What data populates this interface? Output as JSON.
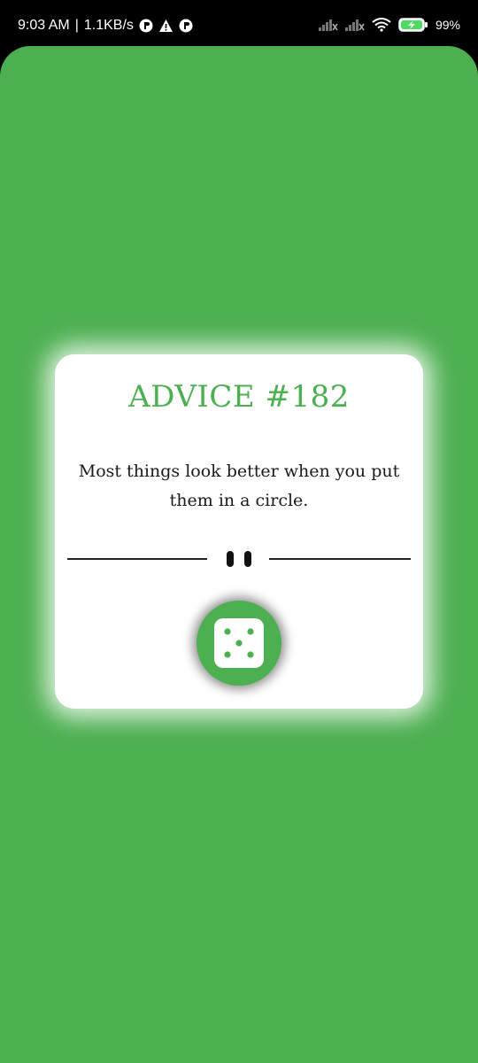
{
  "status_bar": {
    "time": "9:03 AM",
    "separator": "|",
    "speed": "1.1KB/s",
    "battery": "99%",
    "icons": [
      "p-icon",
      "warning-icon",
      "p-icon",
      "signal-icon",
      "signal-icon",
      "wifi-icon",
      "battery-charging-icon"
    ]
  },
  "card": {
    "title": "ADVICE #182",
    "advice_text": "Most things look better when you put them in a circle."
  },
  "colors": {
    "background": "#4CAF50",
    "title": "#4CAF50",
    "card": "#FFFFFF",
    "text": "#1A1A1A"
  },
  "controls": {
    "divider_icon": "pause-icon",
    "action_icon": "dice-icon"
  }
}
